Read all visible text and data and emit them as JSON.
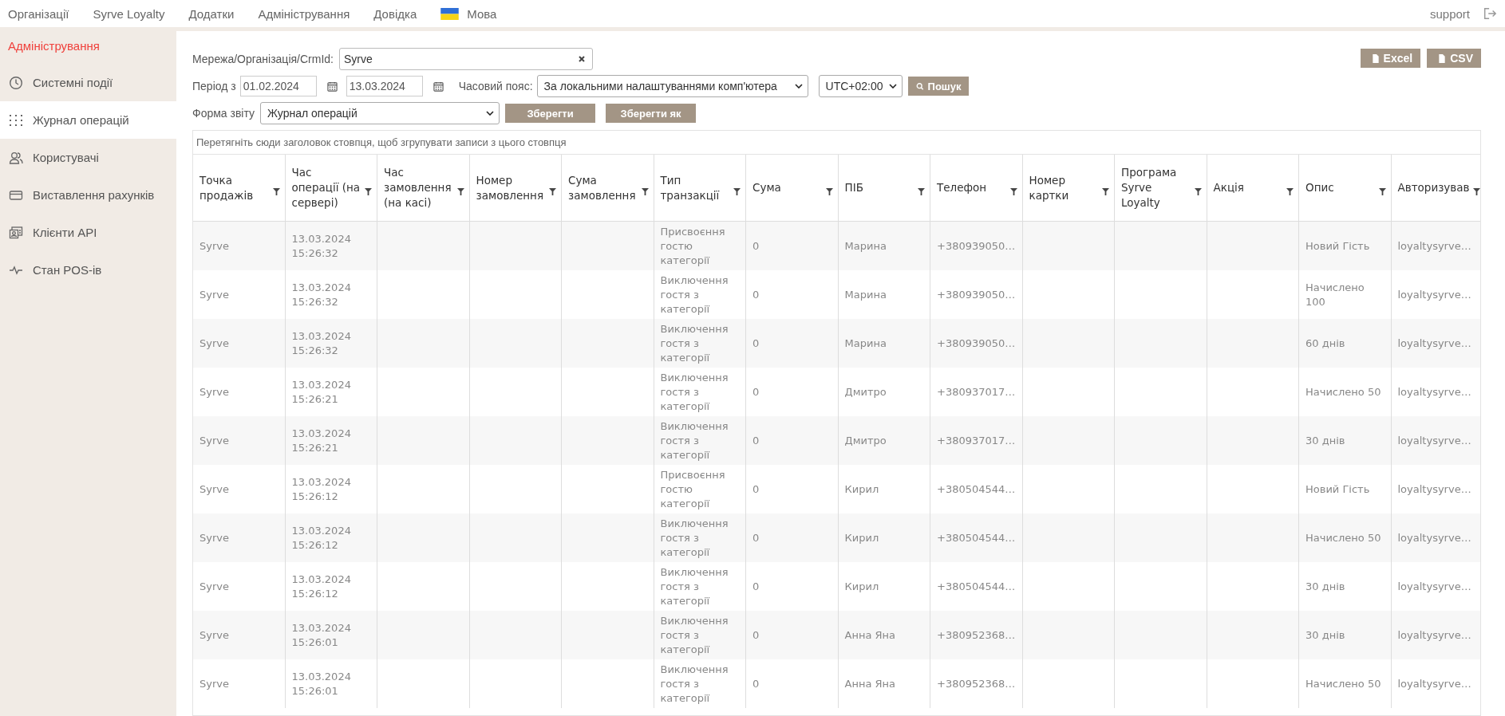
{
  "top_nav": {
    "items": [
      {
        "label": "Організації"
      },
      {
        "label": "Syrve Loyalty"
      },
      {
        "label": "Додатки"
      },
      {
        "label": "Адміністрування"
      },
      {
        "label": "Довідка"
      },
      {
        "label": "Мова",
        "flag": true
      }
    ],
    "user": "support"
  },
  "sidebar": {
    "title": "Адміністрування",
    "items": [
      {
        "label": "Системні події",
        "selected": false
      },
      {
        "label": "Журнал операцій",
        "selected": true
      },
      {
        "label": "Користувачі",
        "selected": false
      },
      {
        "label": "Виставлення рахунків",
        "selected": false
      },
      {
        "label": "Клієнти API",
        "selected": false
      },
      {
        "label": "Стан POS-ів",
        "selected": false
      }
    ]
  },
  "filters": {
    "org_label": "Мережа/Організація/CrmId:",
    "org_value": "Syrve",
    "period_label": "Період з",
    "date_from": "01.02.2024",
    "date_to": "13.03.2024",
    "timezone_label": "Часовий пояс:",
    "timezone_value": "За локальними налаштуваннями комп'ютера",
    "utc_value": "UTC+02:00",
    "search_button": "Пошук",
    "form_label": "Форма звіту",
    "form_value": "Журнал операцій",
    "save_button": "Зберегти",
    "save_as_button": "Зберегти як"
  },
  "export_buttons": [
    "Excel",
    "CSV"
  ],
  "table": {
    "group_hint": "Перетягніть сюди заголовок стовпця, щоб згрупувати записи з цього стовпця",
    "columns": [
      "Точка продажів",
      "Час операції (на сервері)",
      "Час замовлення (на касі)",
      "Номер замовлення",
      "Сума замовлення",
      "Тип транзакції",
      "Сума",
      "ПІБ",
      "Телефон",
      "Номер картки",
      "Програма Syrve Loyalty",
      "Акція",
      "Опис",
      "Авторизував"
    ],
    "rows": [
      {
        "point": "Syrve",
        "time": "13.03.2024 15:26:32",
        "type": "Присвоєння гостю категорії",
        "sum": "0",
        "name": "Марина",
        "phone": "+380939050…",
        "description": "Новий Гість",
        "authorized": "loyaltysyrve…"
      },
      {
        "point": "Syrve",
        "time": "13.03.2024 15:26:32",
        "type": "Виключення гостя з категорії",
        "sum": "0",
        "name": "Марина",
        "phone": "+380939050…",
        "description": "Начислено 100",
        "authorized": "loyaltysyrve…"
      },
      {
        "point": "Syrve",
        "time": "13.03.2024 15:26:32",
        "type": "Виключення гостя з категорії",
        "sum": "0",
        "name": "Марина",
        "phone": "+380939050…",
        "description": "60 днів",
        "authorized": "loyaltysyrve…"
      },
      {
        "point": "Syrve",
        "time": "13.03.2024 15:26:21",
        "type": "Виключення гостя з категорії",
        "sum": "0",
        "name": "Дмитро",
        "phone": "+380937017…",
        "description": "Начислено 50",
        "authorized": "loyaltysyrve…"
      },
      {
        "point": "Syrve",
        "time": "13.03.2024 15:26:21",
        "type": "Виключення гостя з категорії",
        "sum": "0",
        "name": "Дмитро",
        "phone": "+380937017…",
        "description": "30 днів",
        "authorized": "loyaltysyrve…"
      },
      {
        "point": "Syrve",
        "time": "13.03.2024 15:26:12",
        "type": "Присвоєння гостю категорії",
        "sum": "0",
        "name": "Кирил",
        "phone": "+380504544…",
        "description": "Новий Гість",
        "authorized": "loyaltysyrve…"
      },
      {
        "point": "Syrve",
        "time": "13.03.2024 15:26:12",
        "type": "Виключення гостя з категорії",
        "sum": "0",
        "name": "Кирил",
        "phone": "+380504544…",
        "description": "Начислено 50",
        "authorized": "loyaltysyrve…"
      },
      {
        "point": "Syrve",
        "time": "13.03.2024 15:26:12",
        "type": "Виключення гостя з категорії",
        "sum": "0",
        "name": "Кирил",
        "phone": "+380504544…",
        "description": "30 днів",
        "authorized": "loyaltysyrve…"
      },
      {
        "point": "Syrve",
        "time": "13.03.2024 15:26:01",
        "type": "Виключення гостя з категорії",
        "sum": "0",
        "name": "Анна Яна",
        "phone": "+380952368…",
        "description": "30 днів",
        "authorized": "loyaltysyrve…"
      },
      {
        "point": "Syrve",
        "time": "13.03.2024 15:26:01",
        "type": "Виключення гостя з категорії",
        "sum": "0",
        "name": "Анна Яна",
        "phone": "+380952368…",
        "description": "Начислено 50",
        "authorized": "loyaltysyrve…"
      }
    ]
  }
}
